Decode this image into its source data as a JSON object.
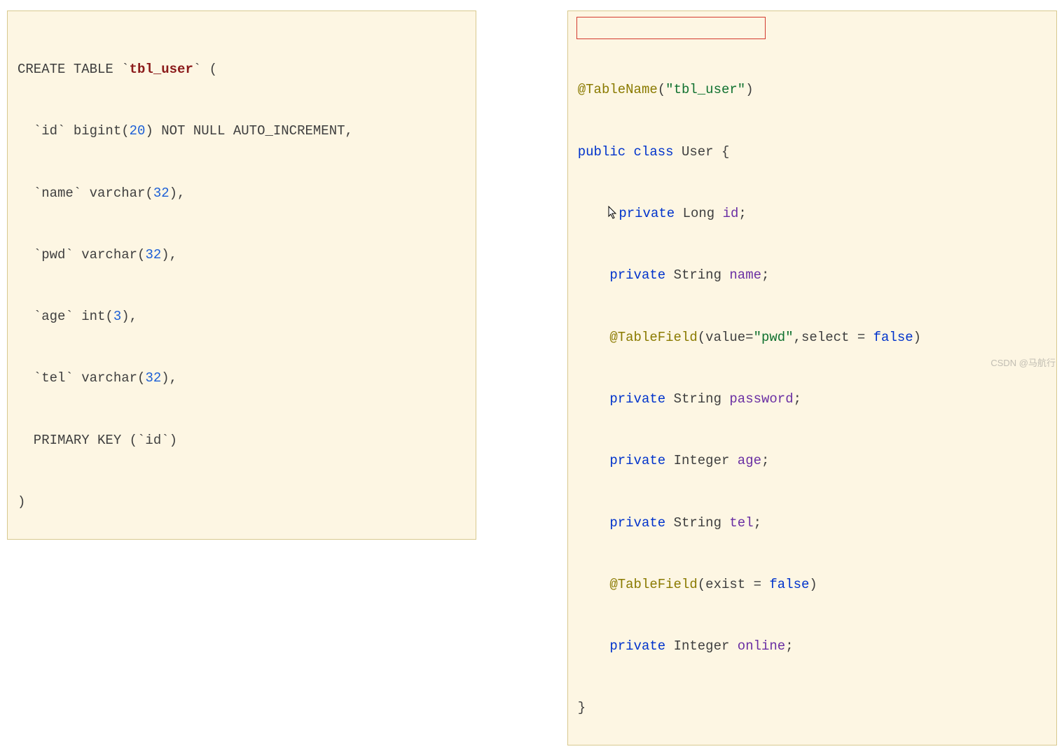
{
  "sql": {
    "l1a": "CREATE TABLE `",
    "l1b": "tbl_user",
    "l1c": "` (",
    "l2a": "  `id` bigint(",
    "l2n": "20",
    "l2b": ") NOT NULL AUTO_INCREMENT,",
    "l3a": "  `name` varchar(",
    "l3n": "32",
    "l3b": "),",
    "l4a": "  `pwd` varchar(",
    "l4n": "32",
    "l4b": "),",
    "l5a": "  `age` int(",
    "l5n": "3",
    "l5b": "),",
    "l6a": "  `tel` varchar(",
    "l6n": "32",
    "l6b": "),",
    "l7": "  PRIMARY KEY (`id`)",
    "l8": ")"
  },
  "java": {
    "l1a": "@TableName",
    "l1b": "(",
    "l1c": "\"tbl_user\"",
    "l1d": ")",
    "l2a": "public",
    "l2b": " class",
    "l2c": " User {",
    "l3a": "private",
    "l3b": " Long ",
    "l3c": "id",
    "l3d": ";",
    "l4a": "private",
    "l4b": " String ",
    "l4c": "name",
    "l4d": ";",
    "l5a": "@TableField",
    "l5b": "(value=",
    "l5c": "\"pwd\"",
    "l5d": ",select = ",
    "l5e": "false",
    "l5f": ")",
    "l6a": "private",
    "l6b": " String ",
    "l6c": "password",
    "l6d": ";",
    "l7a": "private",
    "l7b": " Integer ",
    "l7c": "age",
    "l7d": ";",
    "l8a": "private",
    "l8b": " String ",
    "l8c": "tel",
    "l8d": ";",
    "l9a": "@TableField",
    "l9b": "(exist = ",
    "l9c": "false",
    "l9d": ")",
    "l10a": "private",
    "l10b": " Integer ",
    "l10c": "online",
    "l10d": ";",
    "l11": "}"
  },
  "watermark": "CSDN @马航行"
}
